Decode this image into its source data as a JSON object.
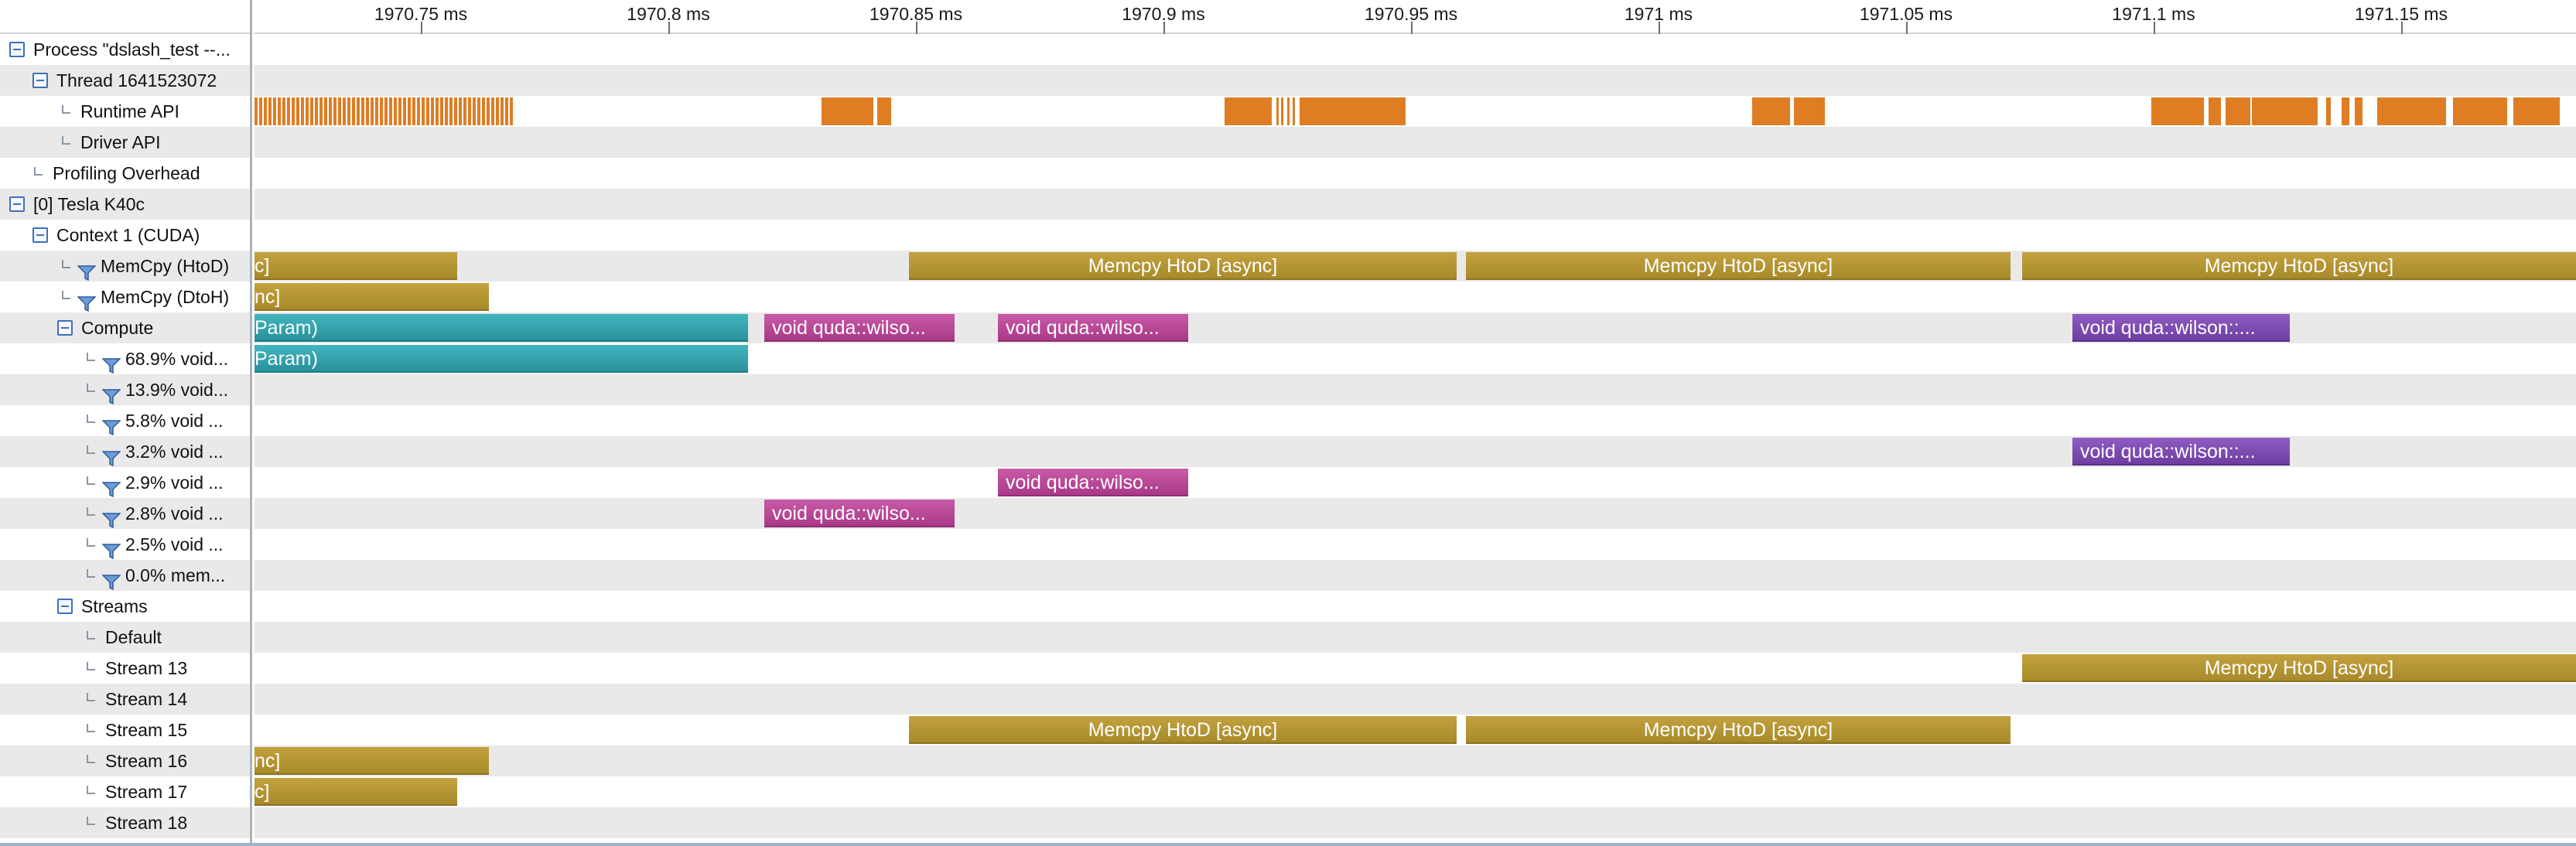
{
  "colors": {
    "memcpy": "#b8982f",
    "runtime_api": "#df7d23",
    "kernel_teal": "#33a5b0",
    "kernel_pink": "#b8479a",
    "kernel_purple": "#7e4db3"
  },
  "ruler": {
    "ticks": [
      "1970.75 ms",
      "1970.8 ms",
      "1970.85 ms",
      "1970.9 ms",
      "1970.95 ms",
      "1971 ms",
      "1971.05 ms",
      "1971.1 ms",
      "1971.15 ms"
    ]
  },
  "tree": {
    "rows": [
      {
        "label": "Process \"dslash_test --...",
        "icon": "collapse-icon"
      },
      {
        "label": "Thread 1641523072",
        "icon": "collapse-icon"
      },
      {
        "label": "Runtime API",
        "icon": "tree-connector-icon"
      },
      {
        "label": "Driver API",
        "icon": "tree-connector-icon"
      },
      {
        "label": "Profiling Overhead",
        "icon": "tree-connector-icon"
      },
      {
        "label": "[0] Tesla K40c",
        "icon": "collapse-icon"
      },
      {
        "label": "Context 1 (CUDA)",
        "icon": "collapse-icon"
      },
      {
        "label": "MemCpy (HtoD)",
        "icon": "filter-icon"
      },
      {
        "label": "MemCpy (DtoH)",
        "icon": "filter-icon"
      },
      {
        "label": "Compute",
        "icon": "collapse-icon"
      },
      {
        "label": "68.9% void...",
        "icon": "filter-icon"
      },
      {
        "label": "13.9% void...",
        "icon": "filter-icon"
      },
      {
        "label": "5.8% void ...",
        "icon": "filter-icon"
      },
      {
        "label": "3.2% void ...",
        "icon": "filter-icon"
      },
      {
        "label": "2.9% void ...",
        "icon": "filter-icon"
      },
      {
        "label": "2.8% void ...",
        "icon": "filter-icon"
      },
      {
        "label": "2.5% void ...",
        "icon": "filter-icon"
      },
      {
        "label": "0.0% mem...",
        "icon": "filter-icon"
      },
      {
        "label": "Streams",
        "icon": "collapse-icon"
      },
      {
        "label": "Default",
        "icon": "tree-connector-icon"
      },
      {
        "label": "Stream 13",
        "icon": "tree-connector-icon"
      },
      {
        "label": "Stream 14",
        "icon": "tree-connector-icon"
      },
      {
        "label": "Stream 15",
        "icon": "tree-connector-icon"
      },
      {
        "label": "Stream 16",
        "icon": "tree-connector-icon"
      },
      {
        "label": "Stream 17",
        "icon": "tree-connector-icon"
      },
      {
        "label": "Stream 18",
        "icon": "tree-connector-icon"
      }
    ]
  },
  "timeline": {
    "memcpy_htod_async": "Memcpy HtoD [async]",
    "clip_nc": "nc]",
    "clip_c": "c]",
    "clip_param": "Param)",
    "kernel_wilso": "void quda::wilso...",
    "kernel_wilson": "void quda::wilson::..."
  }
}
